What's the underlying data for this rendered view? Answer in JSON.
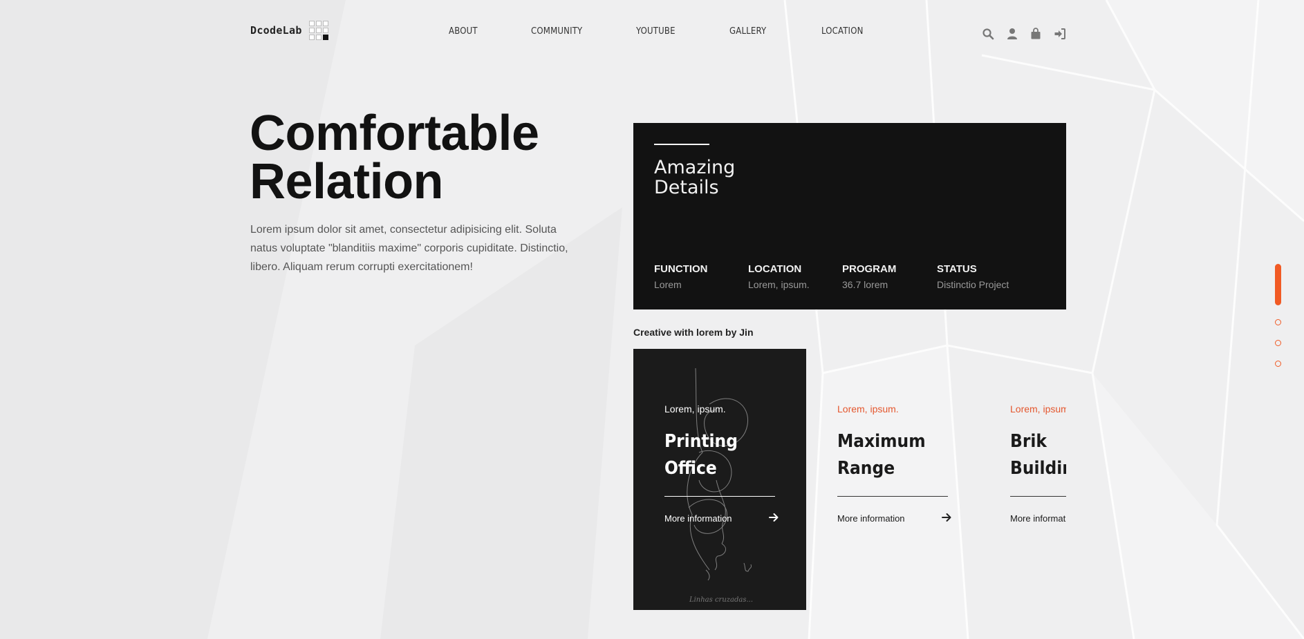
{
  "header": {
    "brand": "DcodeLab",
    "nav": [
      "ABOUT",
      "COMMUNITY",
      "YOUTUBE",
      "GALLERY",
      "LOCATION"
    ],
    "icons": [
      "search-icon",
      "user-icon",
      "shopping-bag-icon",
      "sign-in-icon"
    ]
  },
  "hero": {
    "title_line1": "Comfortable",
    "title_line2": "Relation",
    "text": "Lorem ipsum dolor sit amet, consectetur adipisicing elit. Soluta natus voluptate \"blanditiis maxime\" corporis cupiditate. Distinctio, libero. Aliquam rerum corrupti exercitationem!"
  },
  "details": {
    "title_line1": "Amazing",
    "title_line2": "Details",
    "columns": [
      {
        "label": "FUNCTION",
        "value": "Lorem"
      },
      {
        "label": "LOCATION",
        "value": "Lorem, ipsum."
      },
      {
        "label": "PROGRAM",
        "value": "36.7 lorem"
      },
      {
        "label": "STATUS",
        "value": "Distinctio Project"
      }
    ]
  },
  "creative_label": "Creative with lorem by Jin",
  "cards": [
    {
      "category": "Lorem, ipsum.",
      "title_line1": "Printing",
      "title_line2": "Office",
      "link": "More information",
      "art_caption": "Linhas cruzadas..."
    },
    {
      "category": "Lorem, ipsum.",
      "title_line1": "Maximum",
      "title_line2": "Range",
      "link": "More information"
    },
    {
      "category": "Lorem, ipsum.",
      "title_line1": "Brik",
      "title_line2": "Building",
      "link": "More information"
    }
  ],
  "pager": {
    "count": 4,
    "active": 0
  },
  "colors": {
    "accent": "#f15a24",
    "accent_text": "#e4572e",
    "dark": "#121212",
    "background": "#efeff0"
  }
}
